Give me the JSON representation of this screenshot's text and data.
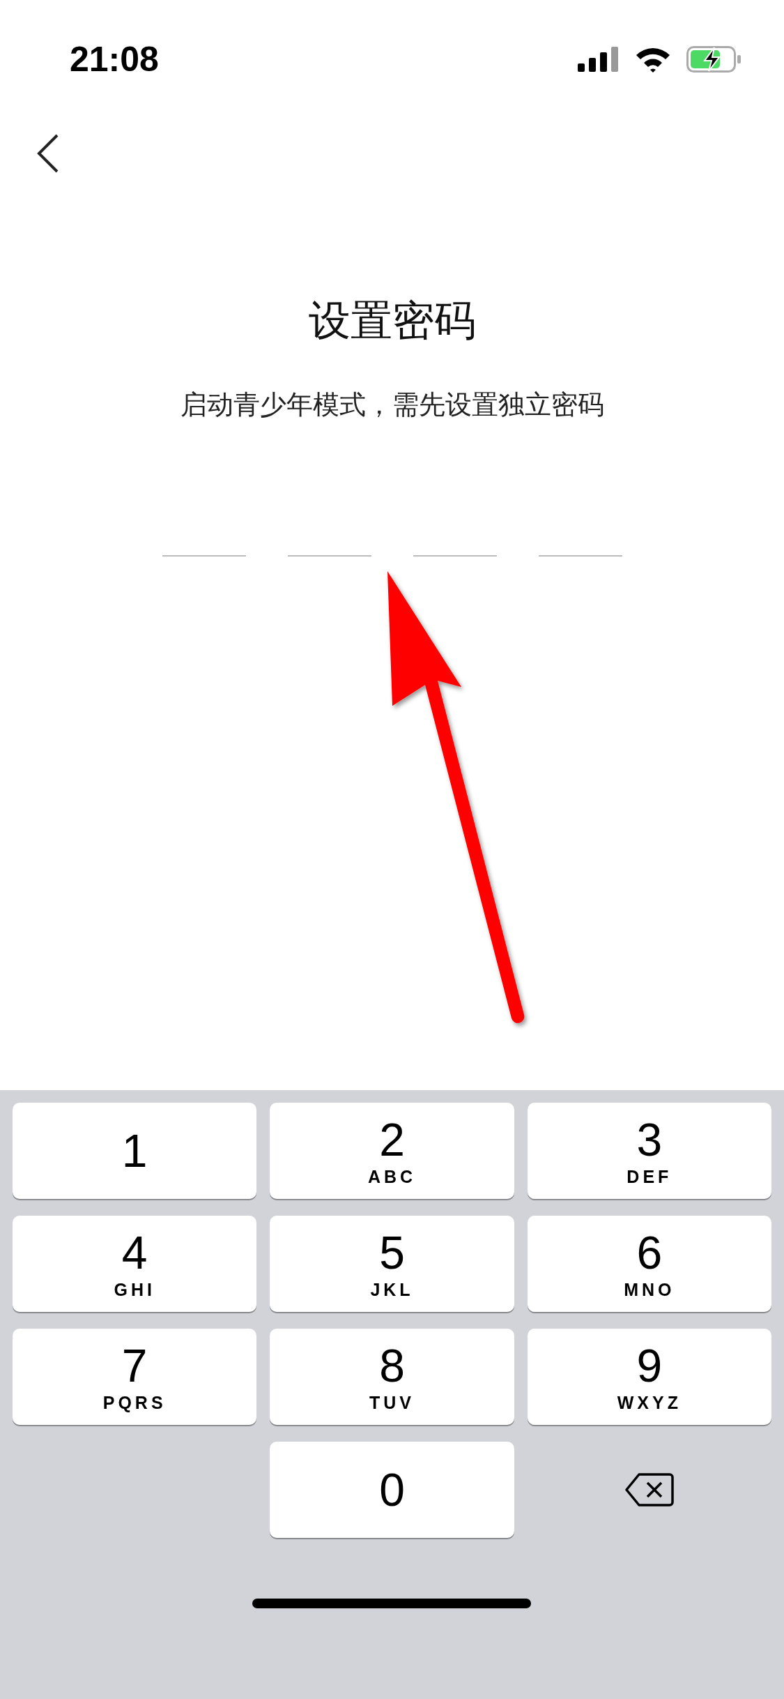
{
  "status_bar": {
    "time": "21:08",
    "battery_charging": true
  },
  "title": "设置密码",
  "subtitle": "启动青少年模式，需先设置独立密码",
  "pin_slots": [
    {
      "filled": false
    },
    {
      "filled": false
    },
    {
      "filled": false
    },
    {
      "filled": false
    }
  ],
  "keypad": [
    {
      "kind": "digit",
      "digit": "1"
    },
    {
      "kind": "digit",
      "digit": "2",
      "letters": "ABC"
    },
    {
      "kind": "digit",
      "digit": "3",
      "letters": "DEF"
    },
    {
      "kind": "digit",
      "digit": "4",
      "letters": "GHI"
    },
    {
      "kind": "digit",
      "digit": "5",
      "letters": "JKL"
    },
    {
      "kind": "digit",
      "digit": "6",
      "letters": "MNO"
    },
    {
      "kind": "digit",
      "digit": "7",
      "letters": "PQRS"
    },
    {
      "kind": "digit",
      "digit": "8",
      "letters": "TUV"
    },
    {
      "kind": "digit",
      "digit": "9",
      "letters": "WXYZ"
    },
    {
      "kind": "empty"
    },
    {
      "kind": "digit",
      "digit": "0"
    },
    {
      "kind": "delete"
    }
  ]
}
